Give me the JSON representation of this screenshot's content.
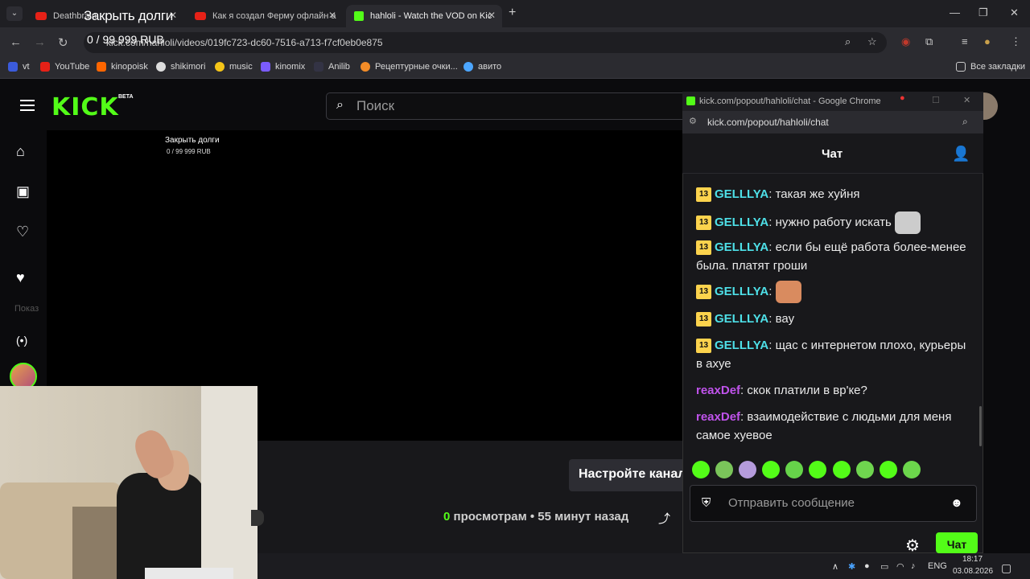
{
  "overlay": {
    "title": "Закрыть долги",
    "progress": "0 / 99 999 RUB"
  },
  "browser": {
    "tabs": [
      {
        "label": "Deathbrain",
        "type": "youtube"
      },
      {
        "label": "Как я создал Ферму офлайн а",
        "type": "youtube"
      },
      {
        "label": "hahloli - Watch the VOD on Kic",
        "type": "kick",
        "active": true
      }
    ],
    "url": "kick.com/hahloli/videos/019fc723-dc60-7516-a713-f7cf0eb0e875",
    "bookmarks": [
      "vt",
      "YouTube",
      "kinopoisk",
      "shikimori",
      "music",
      "kinomix",
      "Anilib",
      "Рецептурные очки...",
      "авито"
    ],
    "all_bookmarks": "Все закладки"
  },
  "kick": {
    "logo": "KICK",
    "beta": "BETA",
    "search_placeholder": "Поиск",
    "sidebar_hidden": "Показ",
    "player_title": "Закрыть долги",
    "player_progress": "0 / 99 999 RUB",
    "tune_button": "Настройте канал",
    "views_count": "0",
    "views_label": "просмотрам",
    "views_sep": "•",
    "time_ago": "55 минут назад"
  },
  "popup": {
    "title": "kick.com/popout/hahloli/chat - Google Chrome",
    "url": "kick.com/popout/hahloli/chat",
    "chat_title": "Чат",
    "messages": [
      {
        "badge": "13",
        "user": "GELLLYA",
        "text": "такая же хуйня"
      },
      {
        "badge": "13",
        "user": "GELLLYA",
        "text": "нужно работу искать"
      },
      {
        "badge": "13",
        "user": "GELLLYA",
        "text": "если бы ещё работа более-менее была. платят гроши"
      },
      {
        "badge": "13",
        "user": "GELLLYA",
        "text": ""
      },
      {
        "badge": "13",
        "user": "GELLLYA",
        "text": "вау"
      },
      {
        "badge": "13",
        "user": "GELLLYA",
        "text": "щас с интернетом плохо, курьеры в ахуе"
      },
      {
        "user": "reaxDef",
        "text": "скок платили в вр'ке?"
      },
      {
        "user": "reaxDef",
        "text": "взаимодействие с людьми для меня самое хуевое"
      }
    ],
    "input_placeholder": "Отправить сообщение",
    "send_label": "Чат"
  },
  "taskbar": {
    "lang": "ENG",
    "time": "18:17",
    "date": "03.08.2026"
  },
  "colors": {
    "kick_green": "#53fc18",
    "user_cyan": "#4ee0e8",
    "user_purple": "#c053ec",
    "badge_yellow": "#fcd34d"
  }
}
